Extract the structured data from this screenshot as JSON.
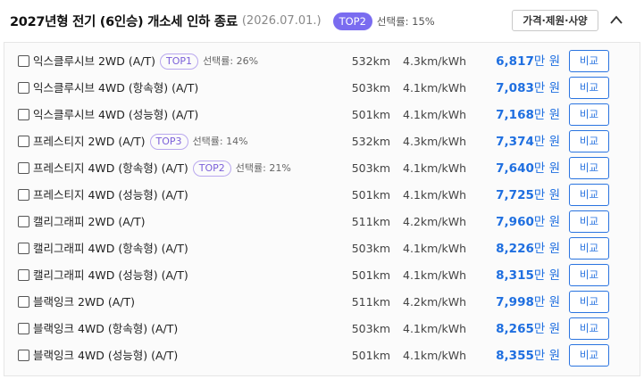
{
  "header": {
    "title": "2027년형 전기 (6인승) 개소세 인하 종료",
    "date": "(2026.07.01.)",
    "badge": "TOP2",
    "rate": "선택률: 15%",
    "options_button": "가격·제원·사양"
  },
  "icons": {
    "collapse": "chevron-up-icon",
    "checkbox": "checkbox-icon"
  },
  "colors": {
    "accent": "#1f6fe0",
    "badge_bg": "#7a6cf0",
    "pill_border": "#b9a8ee",
    "pill_text": "#7b5fd9"
  },
  "price_unit": "만 원",
  "compare_label": "비교",
  "trims": [
    {
      "name": "익스클루시브 2WD (A/T)",
      "badge": "TOP1",
      "rate": "선택률: 26%",
      "range": "532km",
      "efficiency": "4.3km/kWh",
      "price": "6,817"
    },
    {
      "name": "익스클루시브 4WD (항속형) (A/T)",
      "badge": "",
      "rate": "",
      "range": "503km",
      "efficiency": "4.1km/kWh",
      "price": "7,083"
    },
    {
      "name": "익스클루시브 4WD (성능형) (A/T)",
      "badge": "",
      "rate": "",
      "range": "501km",
      "efficiency": "4.1km/kWh",
      "price": "7,168"
    },
    {
      "name": "프레스티지 2WD (A/T)",
      "badge": "TOP3",
      "rate": "선택률: 14%",
      "range": "532km",
      "efficiency": "4.3km/kWh",
      "price": "7,374"
    },
    {
      "name": "프레스티지 4WD (항속형) (A/T)",
      "badge": "TOP2",
      "rate": "선택률: 21%",
      "range": "503km",
      "efficiency": "4.1km/kWh",
      "price": "7,640"
    },
    {
      "name": "프레스티지 4WD (성능형) (A/T)",
      "badge": "",
      "rate": "",
      "range": "501km",
      "efficiency": "4.1km/kWh",
      "price": "7,725"
    },
    {
      "name": "캘리그래피 2WD (A/T)",
      "badge": "",
      "rate": "",
      "range": "511km",
      "efficiency": "4.2km/kWh",
      "price": "7,960"
    },
    {
      "name": "캘리그래피 4WD (항속형) (A/T)",
      "badge": "",
      "rate": "",
      "range": "503km",
      "efficiency": "4.1km/kWh",
      "price": "8,226"
    },
    {
      "name": "캘리그래피 4WD (성능형) (A/T)",
      "badge": "",
      "rate": "",
      "range": "501km",
      "efficiency": "4.1km/kWh",
      "price": "8,315"
    },
    {
      "name": "블랙잉크 2WD (A/T)",
      "badge": "",
      "rate": "",
      "range": "511km",
      "efficiency": "4.2km/kWh",
      "price": "7,998"
    },
    {
      "name": "블랙잉크 4WD (항속형) (A/T)",
      "badge": "",
      "rate": "",
      "range": "503km",
      "efficiency": "4.1km/kWh",
      "price": "8,265"
    },
    {
      "name": "블랙잉크 4WD (성능형) (A/T)",
      "badge": "",
      "rate": "",
      "range": "501km",
      "efficiency": "4.1km/kWh",
      "price": "8,355"
    }
  ]
}
